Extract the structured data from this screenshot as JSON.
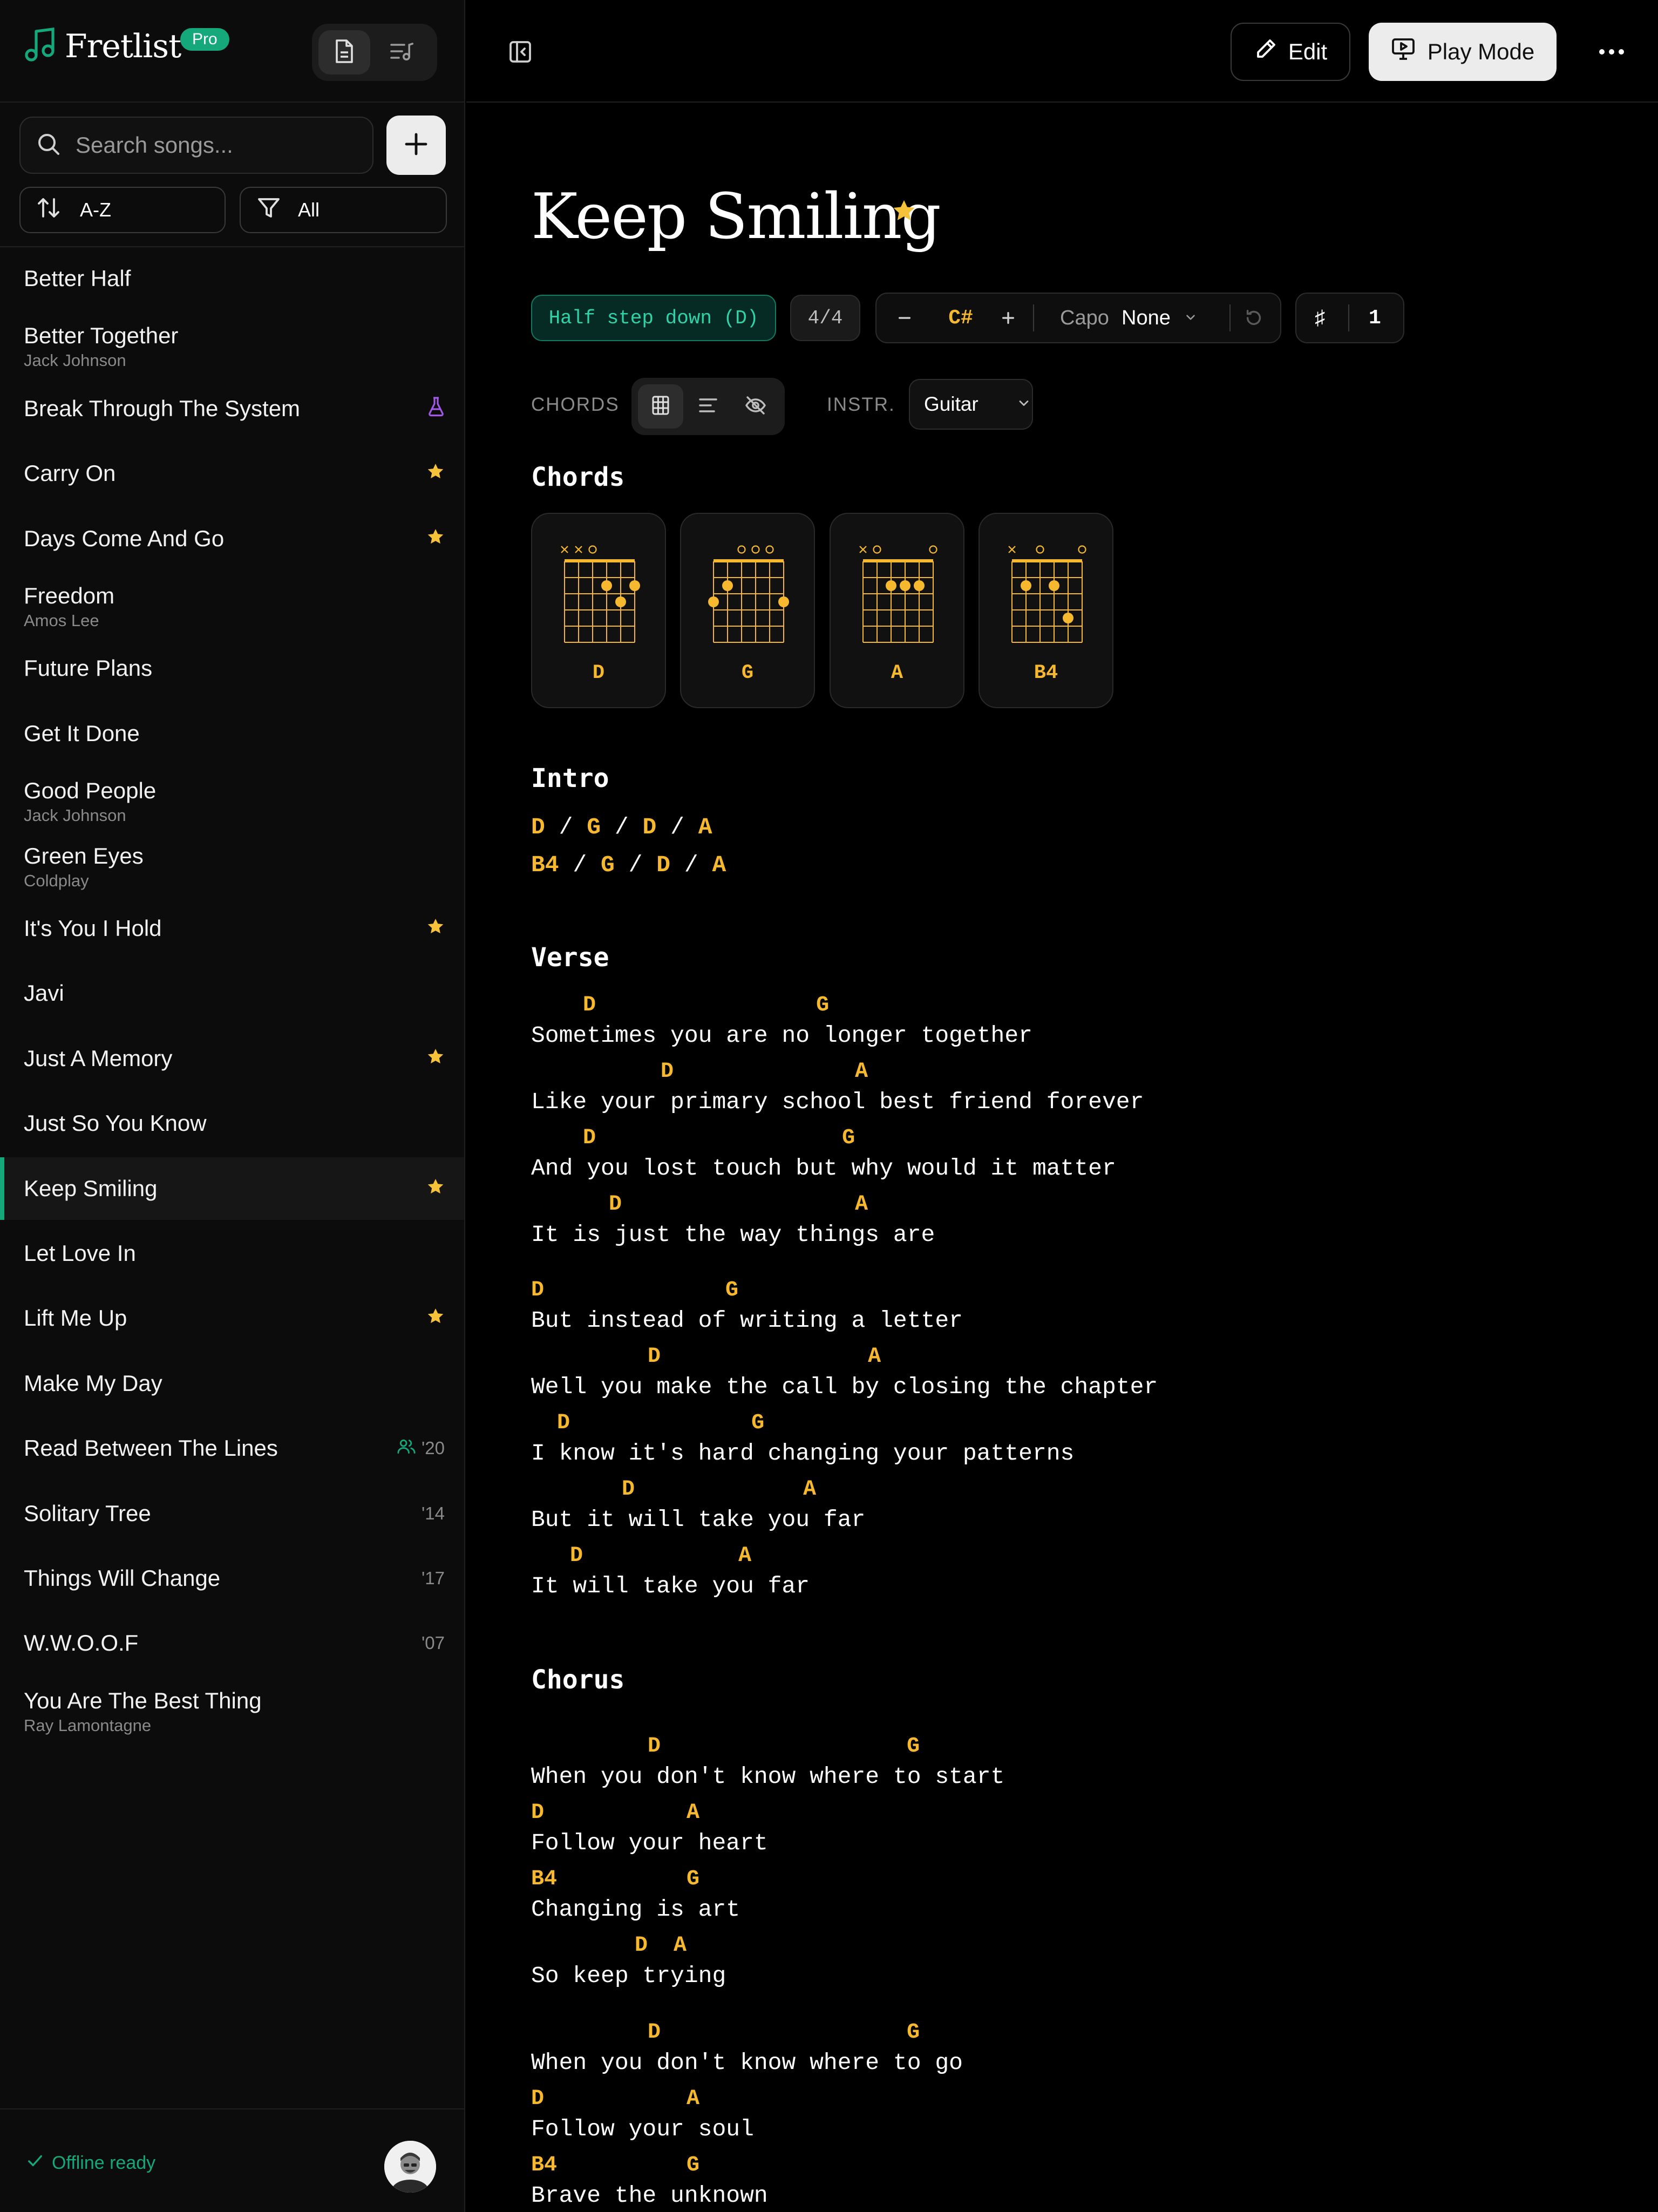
{
  "app": {
    "name": "Fretlist",
    "badge": "Pro"
  },
  "search": {
    "placeholder": "Search songs..."
  },
  "sort": {
    "label": "A-Z"
  },
  "filter": {
    "label": "All"
  },
  "songs": [
    {
      "title": "Better Half",
      "artist": "",
      "meta": "",
      "starred": false
    },
    {
      "title": "Better Together",
      "artist": "Jack Johnson",
      "meta": "",
      "starred": false
    },
    {
      "title": "Break Through The System",
      "artist": "",
      "meta": "",
      "starred": false,
      "icon": "flask-icon"
    },
    {
      "title": "Carry On",
      "artist": "",
      "meta": "",
      "starred": true
    },
    {
      "title": "Days Come And Go",
      "artist": "",
      "meta": "",
      "starred": true
    },
    {
      "title": "Freedom",
      "artist": "Amos Lee",
      "meta": "",
      "starred": false
    },
    {
      "title": "Future Plans",
      "artist": "",
      "meta": "",
      "starred": false
    },
    {
      "title": "Get It Done",
      "artist": "",
      "meta": "",
      "starred": false
    },
    {
      "title": "Good People",
      "artist": "Jack Johnson",
      "meta": "",
      "starred": false
    },
    {
      "title": "Green Eyes",
      "artist": "Coldplay",
      "meta": "",
      "starred": false
    },
    {
      "title": "It's You I Hold",
      "artist": "",
      "meta": "",
      "starred": true
    },
    {
      "title": "Javi",
      "artist": "",
      "meta": "",
      "starred": false
    },
    {
      "title": "Just A Memory",
      "artist": "",
      "meta": "",
      "starred": true
    },
    {
      "title": "Just So You Know",
      "artist": "",
      "meta": "",
      "starred": false
    },
    {
      "title": "Keep Smiling",
      "artist": "",
      "meta": "",
      "starred": true,
      "active": true
    },
    {
      "title": "Let Love In",
      "artist": "",
      "meta": "",
      "starred": false
    },
    {
      "title": "Lift Me Up",
      "artist": "",
      "meta": "",
      "starred": true
    },
    {
      "title": "Make My Day",
      "artist": "",
      "meta": "",
      "starred": false
    },
    {
      "title": "Read Between The Lines",
      "artist": "",
      "meta": "'20",
      "starred": false,
      "icon": "users-icon"
    },
    {
      "title": "Solitary Tree",
      "artist": "",
      "meta": "'14",
      "starred": false
    },
    {
      "title": "Things Will Change",
      "artist": "",
      "meta": "'17",
      "starred": false
    },
    {
      "title": "W.W.O.O.F",
      "artist": "",
      "meta": "'07",
      "starred": false
    },
    {
      "title": "You Are The Best Thing",
      "artist": "Ray Lamontagne",
      "meta": "",
      "starred": false
    }
  ],
  "footer": {
    "status": "Offline ready"
  },
  "toolbar": {
    "edit_label": "Edit",
    "play_label": "Play Mode"
  },
  "song": {
    "title": "Keep Smiling",
    "tuning": "Half step down (D)",
    "time_signature": "4/4",
    "key": "C#",
    "capo_label": "Capo",
    "capo_value": "None",
    "accidental": "♯",
    "accidental_count": "1"
  },
  "options": {
    "chords_label": "CHORDS",
    "instrument_label": "INSTR.",
    "instrument_value": "Guitar"
  },
  "chords_heading": "Chords",
  "chords": [
    "D",
    "G",
    "A",
    "B4"
  ],
  "intro": {
    "heading": "Intro",
    "lines": [
      [
        "D",
        "G",
        "D",
        "A"
      ],
      [
        "B4",
        "G",
        "D",
        "A"
      ]
    ]
  },
  "verse": {
    "heading": "Verse",
    "lines": [
      {
        "chords": "    D                 G",
        "lyric": "Sometimes you are no longer together"
      },
      {
        "chords": "          D              A",
        "lyric": "Like your primary school best friend forever"
      },
      {
        "chords": "    D                   G",
        "lyric": "And you lost touch but why would it matter"
      },
      {
        "chords": "      D                  A",
        "lyric": "It is just the way things are"
      },
      {
        "chords": "D              G",
        "lyric": "But instead of writing a letter"
      },
      {
        "chords": "         D                A",
        "lyric": "Well you make the call by closing the chapter"
      },
      {
        "chords": "  D              G",
        "lyric": "I know it's hard changing your patterns"
      },
      {
        "chords": "       D             A",
        "lyric": "But it will take you far"
      },
      {
        "chords": "   D            A",
        "lyric": "It will take you far"
      }
    ]
  },
  "chorus": {
    "heading": "Chorus",
    "lines": [
      {
        "chords": "         D                   G",
        "lyric": "When you don't know where to start"
      },
      {
        "chords": "D           A",
        "lyric": "Follow your heart"
      },
      {
        "chords": "B4          G",
        "lyric": "Changing is art"
      },
      {
        "chords": "        D  A",
        "lyric": "So keep trying"
      },
      {
        "chords": "         D                   G",
        "lyric": "When you don't know where to go"
      },
      {
        "chords": "D           A",
        "lyric": "Follow your soul"
      },
      {
        "chords": "B4          G",
        "lyric": "Brave the unknown"
      }
    ]
  },
  "colors": {
    "accent": "#14a87a",
    "chord": "#f5b82e",
    "star": "#f5c23a",
    "background": "#000000"
  }
}
